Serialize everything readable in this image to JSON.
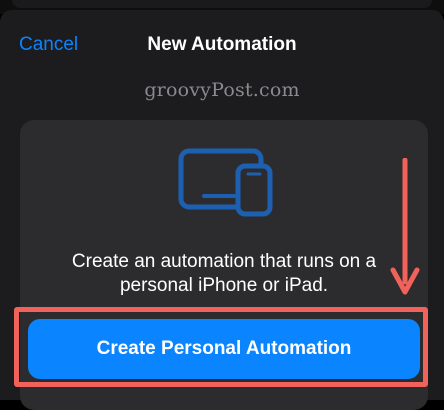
{
  "nav": {
    "cancel_label": "Cancel",
    "title": "New Automation"
  },
  "watermark": "groovyPost.com",
  "card": {
    "icon": "ipad-iphone-devices-icon",
    "description_line1": "Create an automation that runs on a",
    "description_line2": "personal iPhone or iPad.",
    "button_label": "Create Personal Automation"
  },
  "annotation": {
    "arrow_icon": "down-arrow-icon",
    "color": "#f0625a"
  },
  "colors": {
    "accent": "#0a84ff",
    "sheet_bg": "#1c1c1e",
    "card_bg": "#2c2c2e",
    "icon_blue": "#1d5fb0"
  }
}
